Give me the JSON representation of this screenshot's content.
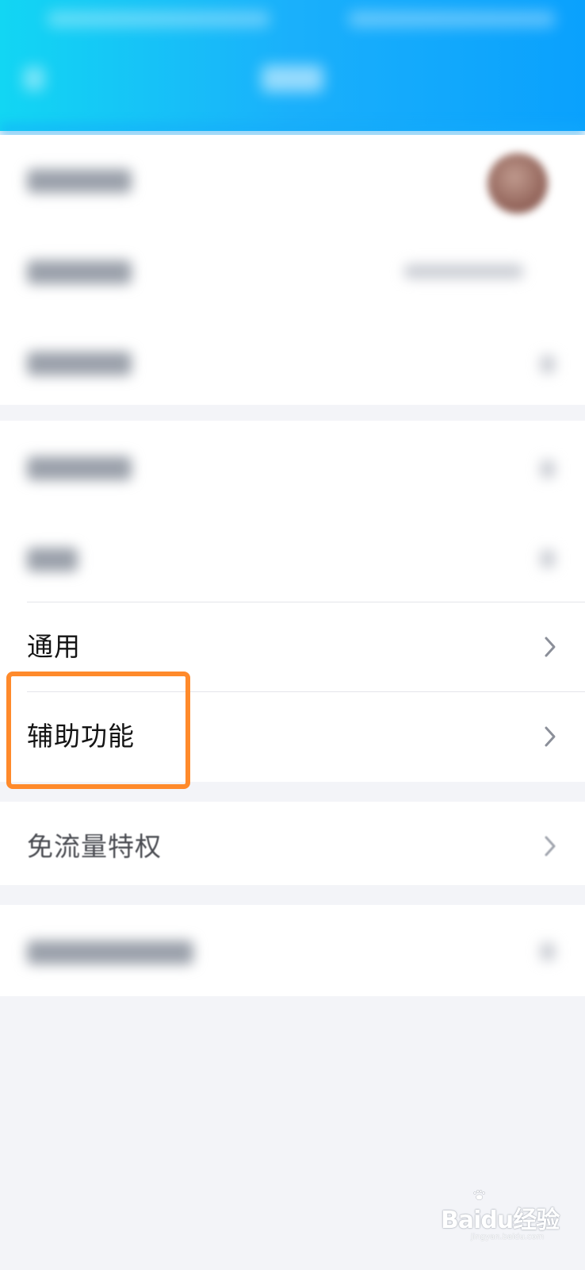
{
  "settings": {
    "items": [
      {
        "label": "通用"
      },
      {
        "label": "辅助功能"
      },
      {
        "label": "免流量特权"
      }
    ]
  },
  "watermark": {
    "brand": "Baidu经验",
    "url": "jingyan.baidu.com"
  },
  "colors": {
    "header_start": "#12d6f3",
    "header_end": "#0aa1fd",
    "highlight": "#ff8a2b",
    "background": "#f3f4f8"
  },
  "icons": [
    "chevron-right-icon",
    "back-arrow-icon",
    "avatar"
  ]
}
